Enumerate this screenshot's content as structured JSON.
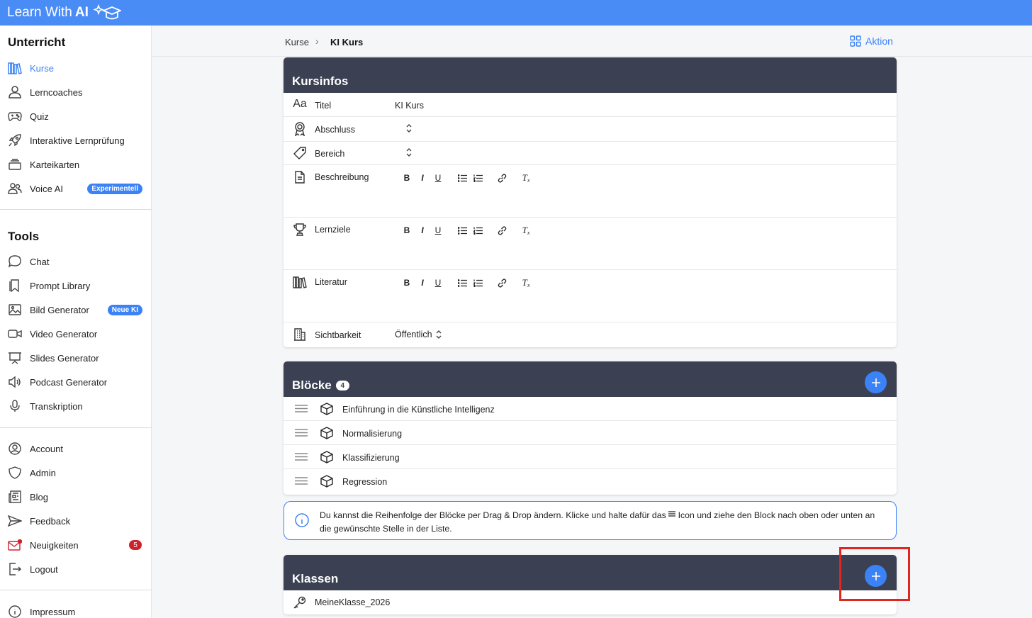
{
  "app": {
    "brand_text": "Learn With",
    "brand_ai": "AI"
  },
  "sidebar": {
    "section1_title": "Unterricht",
    "section1_items": [
      {
        "label": "Kurse",
        "icon": "library-icon",
        "active": true
      },
      {
        "label": "Lerncoaches",
        "icon": "user-icon"
      },
      {
        "label": "Quiz",
        "icon": "gamepad-icon"
      },
      {
        "label": "Interaktive Lernprüfung",
        "icon": "rocket-icon"
      },
      {
        "label": "Karteikarten",
        "icon": "cards-icon"
      },
      {
        "label": "Voice AI",
        "icon": "users-icon",
        "badge": "Experimentell"
      }
    ],
    "section2_title": "Tools",
    "section2_items": [
      {
        "label": "Chat",
        "icon": "chat-icon"
      },
      {
        "label": "Prompt Library",
        "icon": "bookmark-icon"
      },
      {
        "label": "Bild Generator",
        "icon": "image-icon",
        "badge": "Neue KI"
      },
      {
        "label": "Video Generator",
        "icon": "video-icon"
      },
      {
        "label": "Slides Generator",
        "icon": "presentation-icon"
      },
      {
        "label": "Podcast Generator",
        "icon": "speaker-icon"
      },
      {
        "label": "Transkription",
        "icon": "microphone-icon"
      }
    ],
    "section3_items": [
      {
        "label": "Account",
        "icon": "account-icon"
      },
      {
        "label": "Admin",
        "icon": "shield-icon"
      },
      {
        "label": "Blog",
        "icon": "newspaper-icon"
      },
      {
        "label": "Feedback",
        "icon": "send-icon"
      },
      {
        "label": "Neuigkeiten",
        "icon": "mail-icon",
        "count": "5"
      },
      {
        "label": "Logout",
        "icon": "logout-icon"
      }
    ],
    "footer_item": {
      "label": "Impressum",
      "icon": "info-icon"
    }
  },
  "header": {
    "breadcrumb": [
      "Kurse",
      "KI Kurs"
    ],
    "action_label": "Aktion"
  },
  "kursinfos": {
    "title": "Kursinfos",
    "fields": {
      "titel_label": "Titel",
      "titel_value": "KI Kurs",
      "abschluss_label": "Abschluss",
      "bereich_label": "Bereich",
      "beschreibung_label": "Beschreibung",
      "lernziele_label": "Lernziele",
      "literatur_label": "Literatur",
      "sichtbarkeit_label": "Sichtbarkeit",
      "sichtbarkeit_value": "Öffentlich"
    },
    "toolbar": {
      "bold": "B",
      "italic": "I",
      "underline": "U",
      "clear": "T"
    }
  },
  "bloecke": {
    "title": "Blöcke",
    "count": "4",
    "items": [
      "Einführung in die Künstliche Intelligenz",
      "Normalisierung",
      "Klassifizierung",
      "Regression"
    ]
  },
  "info_box": {
    "text_before": "Du kannst die Reihenfolge der Blöcke per Drag & Drop ändern. Klicke und halte dafür das",
    "text_after": "Icon und ziehe den Block nach oben oder unten an die gewünschte Stelle in der Liste."
  },
  "klassen": {
    "title": "Klassen",
    "items": [
      "MeineKlasse_2026"
    ]
  },
  "colors": {
    "accent": "#3b82f6",
    "topbar": "#4a8cf6",
    "card_header": "#3b4052",
    "highlight": "#e0261e"
  }
}
